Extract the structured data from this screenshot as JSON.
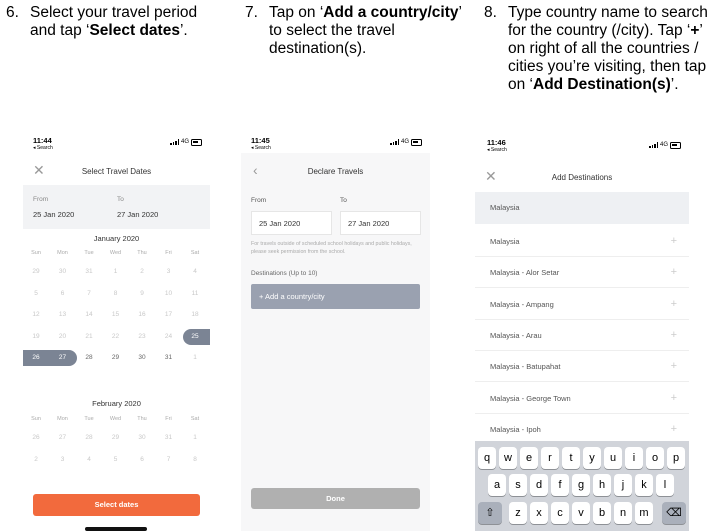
{
  "instructions": [
    {
      "num": "6.",
      "parts": [
        {
          "t": "Select your travel period and tap ‘"
        },
        {
          "t": "Select dates",
          "b": true
        },
        {
          "t": "’."
        }
      ]
    },
    {
      "num": "7.",
      "parts": [
        {
          "t": "Tap on ‘"
        },
        {
          "t": "Add a country/city",
          "b": true
        },
        {
          "t": "’ to select the travel destination(s)."
        }
      ]
    },
    {
      "num": "8.",
      "parts": [
        {
          "t": "Type country name to search for the country (/city). Tap ‘"
        },
        {
          "t": "+",
          "b": true
        },
        {
          "t": "’ on right of all the countries / cities you’re visiting, then tap on ‘"
        },
        {
          "t": "Add Destination(s)",
          "b": true
        },
        {
          "t": "’."
        }
      ]
    }
  ],
  "phones": [
    {
      "time": "11:44",
      "back": "◂ Search",
      "network": "4G"
    },
    {
      "time": "11:45",
      "back": "◂ Search",
      "network": "4G"
    },
    {
      "time": "11:46",
      "back": "◂ Search",
      "network": "4G"
    }
  ],
  "panel1": {
    "title": "Select Travel Dates",
    "close_icon": "✕",
    "from_label": "From",
    "from_value": "25 Jan 2020",
    "to_label": "To",
    "to_value": "27 Jan 2020",
    "month1": "January 2020",
    "month2": "February 2020",
    "weekdays": [
      "Sun",
      "Mon",
      "Tue",
      "Wed",
      "Thu",
      "Fri",
      "Sat"
    ],
    "jan_weeks": [
      [
        "29",
        "30",
        "31",
        "1",
        "2",
        "3",
        "4"
      ],
      [
        "5",
        "6",
        "7",
        "8",
        "9",
        "10",
        "11"
      ],
      [
        "12",
        "13",
        "14",
        "15",
        "16",
        "17",
        "18"
      ],
      [
        "19",
        "20",
        "21",
        "22",
        "23",
        "24",
        "25"
      ],
      [
        "26",
        "27",
        "28",
        "29",
        "30",
        "31",
        "1"
      ]
    ],
    "feb_weeks": [
      [
        "26",
        "27",
        "28",
        "29",
        "30",
        "31",
        "1"
      ],
      [
        "2",
        "3",
        "4",
        "5",
        "6",
        "7",
        "8"
      ]
    ],
    "selected_days": [
      "25",
      "26",
      "27"
    ],
    "button": "Select dates",
    "accent": "#f26a3d"
  },
  "panel2": {
    "title": "Declare Travels",
    "back_icon": "‹",
    "from_label": "From",
    "from_value": "25 Jan 2020",
    "to_label": "To",
    "to_value": "27 Jan 2020",
    "note": "For travels outside of scheduled school holidays and public holidays, please seek permission from the school.",
    "dest_label": "Destinations (Up to 10)",
    "add_button": "+  Add a country/city",
    "done": "Done"
  },
  "panel3": {
    "title": "Add Destinations",
    "close_icon": "✕",
    "search_value": "Malaysia",
    "destinations": [
      "Malaysia",
      "Malaysia - Alor Setar",
      "Malaysia - Ampang",
      "Malaysia - Arau",
      "Malaysia - Batupahat",
      "Malaysia - George Town",
      "Malaysia - Ipoh"
    ],
    "plus_icon": "+",
    "keys_row1": [
      "q",
      "w",
      "e",
      "r",
      "t",
      "y",
      "u",
      "i",
      "o",
      "p"
    ],
    "keys_row2": [
      "a",
      "s",
      "d",
      "f",
      "g",
      "h",
      "j",
      "k",
      "l"
    ],
    "keys_row3": [
      "z",
      "x",
      "c",
      "v",
      "b",
      "n",
      "m"
    ],
    "shift_icon": "⇧",
    "delete_icon": "⌫"
  }
}
